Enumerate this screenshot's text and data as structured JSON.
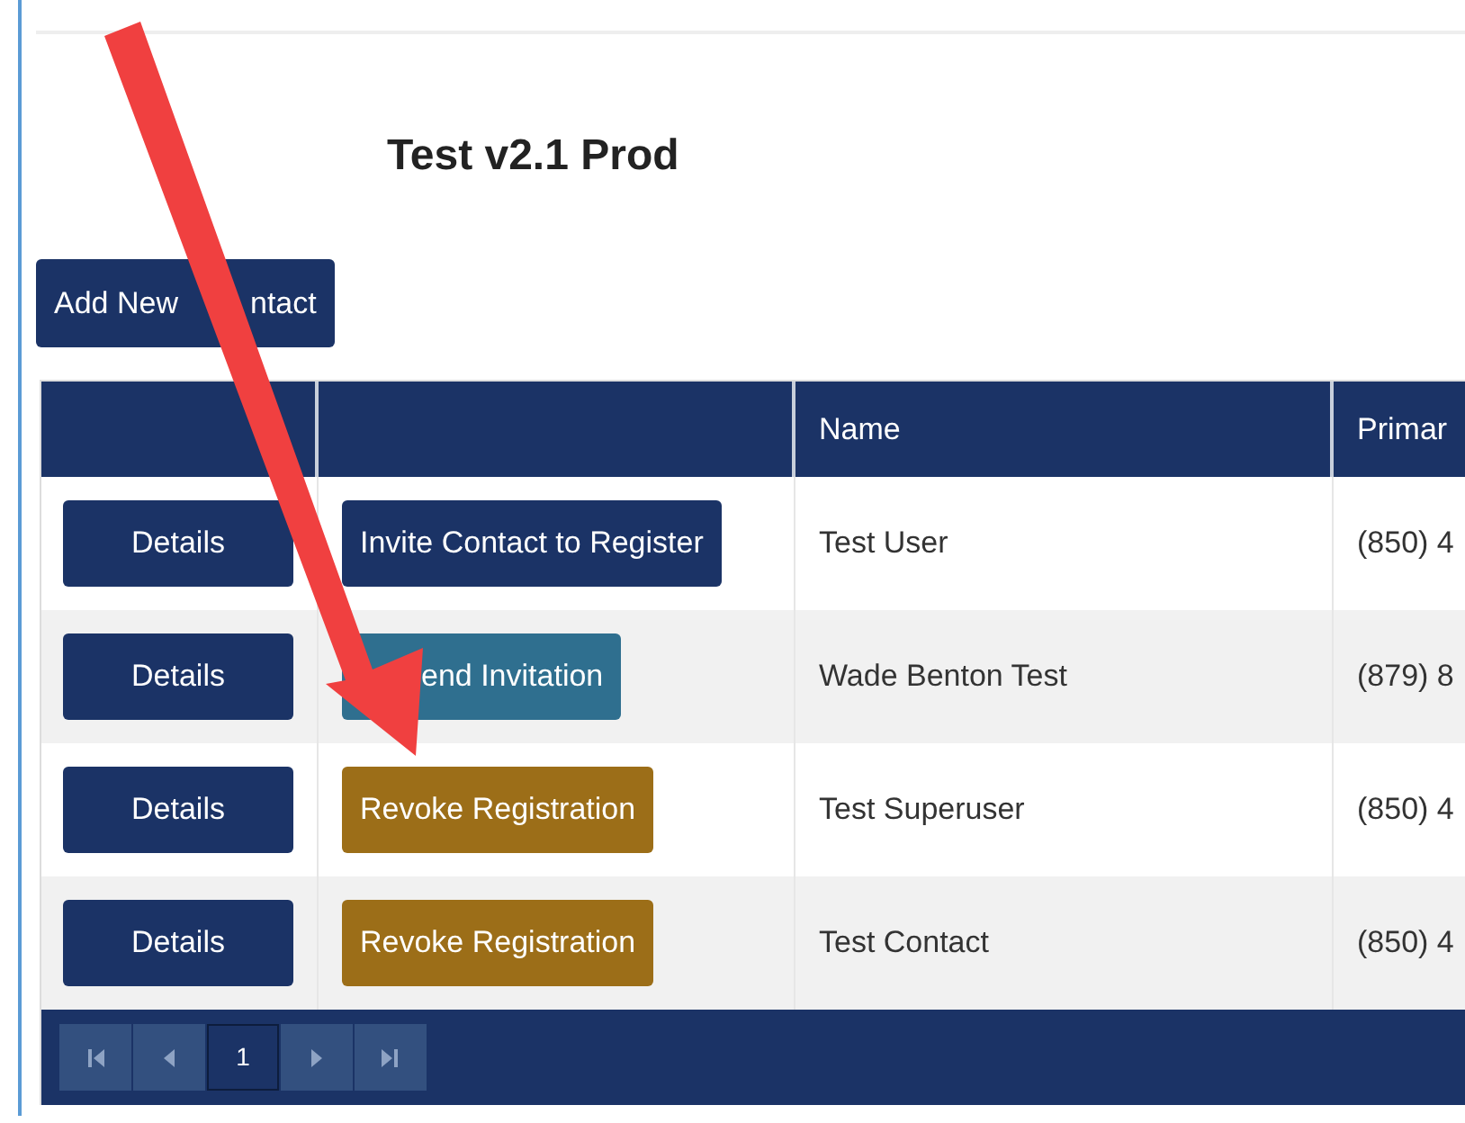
{
  "title": "Test v2.1 Prod",
  "add_button": {
    "parts": [
      "Add New",
      "ntact"
    ]
  },
  "table": {
    "columns": [
      {
        "label": "Name"
      },
      {
        "label": "Primar"
      }
    ],
    "rows": [
      {
        "details": "Details",
        "action": {
          "label": "Invite Contact to Register",
          "kind": "invite"
        },
        "name": "Test User",
        "phone": "(850) 4"
      },
      {
        "details": "Details",
        "action": {
          "label": "end Invitation",
          "kind": "resend",
          "covered": true
        },
        "name": "Wade Benton Test",
        "phone": "(879) 8"
      },
      {
        "details": "Details",
        "action": {
          "label": "Revoke Registration",
          "kind": "revoke"
        },
        "name": "Test Superuser",
        "phone": "(850) 4"
      },
      {
        "details": "Details",
        "action": {
          "label": "Revoke Registration",
          "kind": "revoke"
        },
        "name": "Test Contact",
        "phone": "(850) 4"
      }
    ]
  },
  "pager": {
    "pages": [
      {
        "label": "1",
        "selected": true
      }
    ]
  }
}
